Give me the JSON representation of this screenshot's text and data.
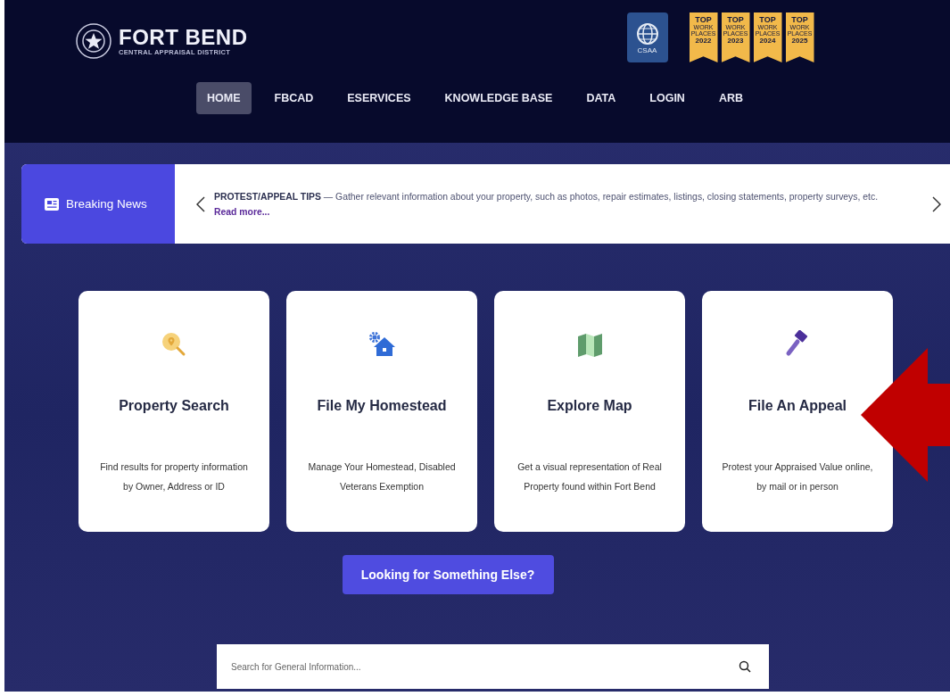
{
  "header": {
    "logo": {
      "title": "FORT BEND",
      "subtitle": "CENTRAL APPRAISAL DISTRICT"
    },
    "certification": {
      "label": "CSAA"
    },
    "awards": [
      {
        "top": "TOP",
        "line1": "WORK",
        "line2": "PLACES",
        "year": "2022"
      },
      {
        "top": "TOP",
        "line1": "WORK",
        "line2": "PLACES",
        "year": "2023"
      },
      {
        "top": "TOP",
        "line1": "WORK",
        "line2": "PLACES",
        "year": "2024"
      },
      {
        "top": "TOP",
        "line1": "WORK",
        "line2": "PLACES",
        "year": "2025"
      }
    ]
  },
  "nav": [
    {
      "label": "HOME",
      "selected": true
    },
    {
      "label": "FBCAD",
      "selected": false
    },
    {
      "label": "ESERVICES",
      "selected": false
    },
    {
      "label": "KNOWLEDGE BASE",
      "selected": false
    },
    {
      "label": "DATA",
      "selected": false
    },
    {
      "label": "LOGIN",
      "selected": false
    },
    {
      "label": "ARB",
      "selected": false
    }
  ],
  "news": {
    "label": "Breaking News",
    "text": "**PROTEST/APPEAL TIPS** — Gather relevant information about your property, such as photos, repair estimates, listings, closing statements, property surveys, etc.",
    "link": "Read more..."
  },
  "cards": [
    {
      "kind": "search",
      "title": "Property Search",
      "text": "Find results for property information by Owner, Address or ID"
    },
    {
      "kind": "homestead",
      "title": "File My Homestead",
      "text": "Manage Your Homestead, Disabled Veterans Exemption"
    },
    {
      "kind": "map",
      "title": "Explore Map",
      "text": "Get a visual representation of Real Property found within Fort Bend"
    },
    {
      "kind": "appeal",
      "title": "File An Appeal",
      "text": "Protest your Appraised Value online, by mail or in person"
    }
  ],
  "cta": "Looking for Something Else?",
  "search": {
    "placeholder": "Search for General Information..."
  },
  "annotation": {
    "kind": "arrow"
  }
}
